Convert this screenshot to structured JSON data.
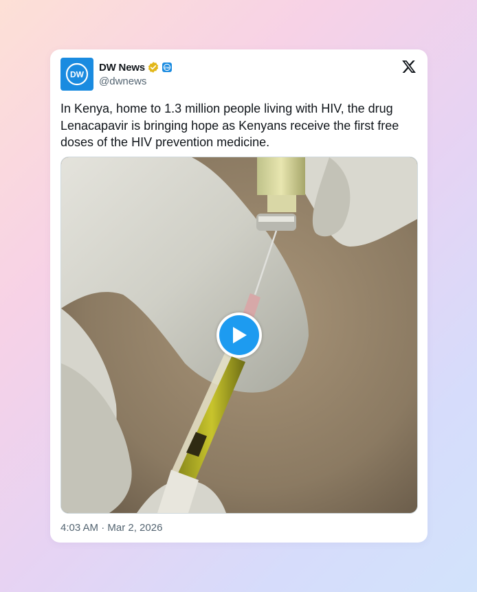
{
  "author": {
    "display_name": "DW News",
    "handle": "@dwnews",
    "avatar_text": "DW",
    "verified_badge": "gold-verified-badge",
    "affiliate_badge": "dw-affiliate-badge"
  },
  "platform_logo": "x-logo-icon",
  "tweet": {
    "text": "In Kenya, home to 1.3 million people living with HIV, the drug Lenacapavir is bringing hope as Kenyans receive the first free doses of the HIV prevention medicine.",
    "media": {
      "type": "video",
      "play_icon": "play-icon"
    },
    "timestamp": "4:03 AM · Mar 2, 2026"
  },
  "colors": {
    "brand_blue": "#1a8be0",
    "play_blue": "#1d9bf0",
    "verified_gold": "#e2b719",
    "text_primary": "#0f1419",
    "text_secondary": "#536471"
  }
}
